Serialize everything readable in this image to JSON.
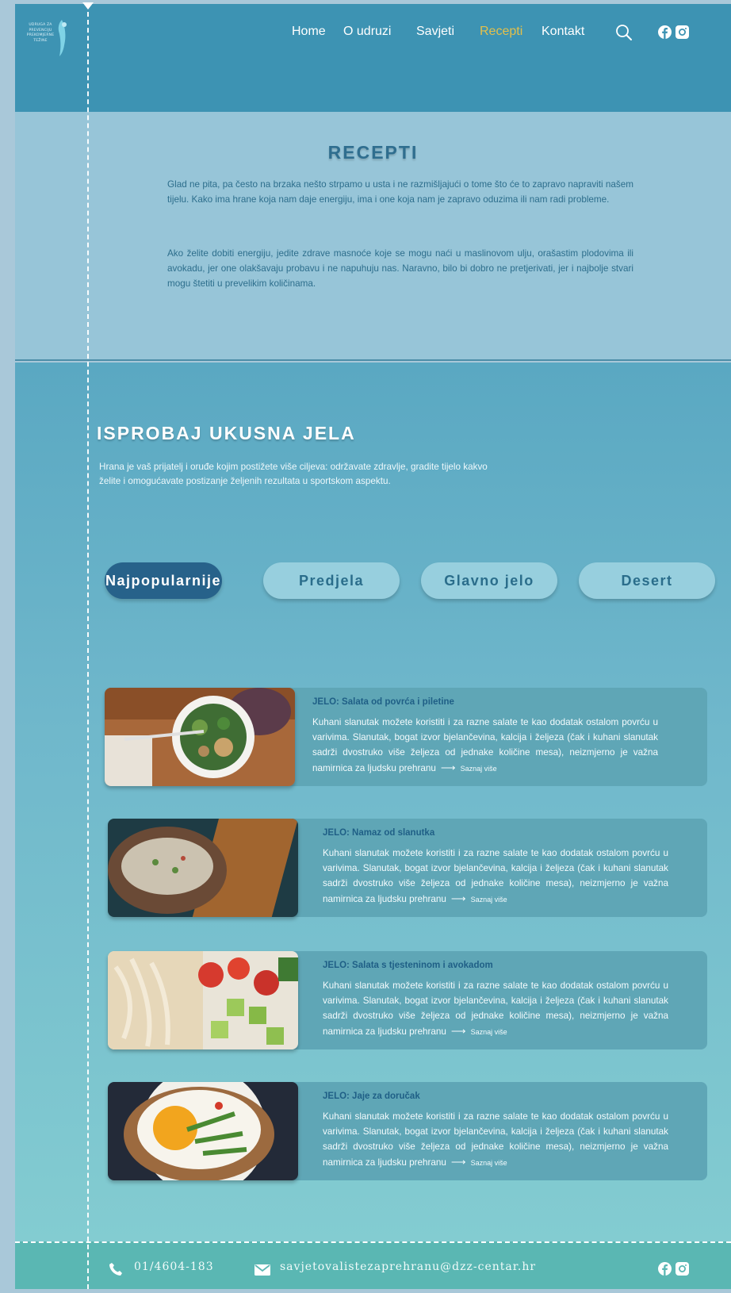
{
  "header": {
    "logo_text": "UDRUGA ZA PREVENCIJU PREKOMJERNE TEŽINE",
    "nav": [
      {
        "label": "Home"
      },
      {
        "label": "O udruzi"
      },
      {
        "label": "Savjeti"
      },
      {
        "label": "Recepti",
        "active": true
      },
      {
        "label": "Kontakt"
      }
    ],
    "icons": [
      "search-icon",
      "facebook-icon",
      "instagram-icon"
    ]
  },
  "intro": {
    "title": "RECEPTI",
    "paragraph1": "Glad ne pita, pa često na brzaka nešto strpamo u usta i ne razmišljajući o tome što će to zapravo napraviti našem tijelu. Kako ima hrane koja nam daje energiju, ima i one koja nam je zapravo oduzima ili nam radi probleme.",
    "paragraph2": "Ako želite dobiti energiju, jedite zdrave masnoće koje se mogu naći u maslinovom ulju, orašastim plodovima ili avokadu, jer one olakšavaju probavu i ne napuhuju nas. Naravno, bilo bi dobro ne pretjerivati, jer i najbolje stvari mogu štetiti u prevelikim količinama."
  },
  "dishes": {
    "title": "ISPROBAJ UKUSNA JELA",
    "subtitle": "Hrana je vaš prijatelj i oruđe kojim postižete više ciljeva: održavate zdravlje, gradite tijelo kakvo želite i omogućavate postizanje željenih rezultata u sportskom aspektu.",
    "tabs": [
      {
        "label": "Najpopularnije",
        "active": true
      },
      {
        "label": "Predjela"
      },
      {
        "label": "Glavno jelo"
      },
      {
        "label": "Desert"
      }
    ],
    "cards": [
      {
        "title": "JELO: Salata od povrća i piletine",
        "text": "Kuhani slanutak možete koristiti i za razne salate te kao dodatak ostalom povrću u varivima. Slanutak, bogat izvor bjelančevina, kalcija i željeza (čak i kuhani slanutak sadrži dvostruko više željeza od jednake količine mesa), neizmjerno je važna namirnica za ljudsku prehranu",
        "more": "Saznaj više"
      },
      {
        "title": "JELO: Namaz od slanutka",
        "text": "Kuhani slanutak možete koristiti i za razne salate te kao dodatak ostalom povrću u varivima. Slanutak, bogat izvor bjelančevina, kalcija i željeza (čak i kuhani slanutak sadrži dvostruko više željeza od jednake količine mesa), neizmjerno je važna namirnica za ljudsku prehranu",
        "more": "Saznaj više"
      },
      {
        "title": "JELO: Salata s tjesteninom i avokadom",
        "text": "Kuhani slanutak možete koristiti i za razne salate te kao dodatak ostalom povrću u varivima. Slanutak, bogat izvor bjelančevina, kalcija i željeza (čak i kuhani slanutak sadrži dvostruko više željeza od jednake količine mesa), neizmjerno je važna namirnica za ljudsku prehranu",
        "more": "Saznaj više"
      },
      {
        "title": "JELO: Jaje za doručak",
        "text": "Kuhani slanutak možete koristiti i za razne salate te kao dodatak ostalom povrću u varivima. Slanutak, bogat izvor bjelančevina, kalcija i željeza (čak i kuhani slanutak sadrži dvostruko više željeza od jednake količine mesa), neizmjerno je važna namirnica za ljudsku prehranu",
        "more": "Saznaj više"
      }
    ]
  },
  "footer": {
    "phone": "01/4604-183",
    "email": "savjetovalistezaprehranu@dzz-centar.hr"
  },
  "colors": {
    "header_bg": "#3d93b3",
    "intro_bg": "#97c5d8",
    "accent_active_nav": "#e3c04b",
    "tab_active_bg": "#27628a",
    "tab_bg": "#97cfde",
    "card_bg": "#5fa6b6",
    "footer_bg": "#5ab7b3"
  }
}
